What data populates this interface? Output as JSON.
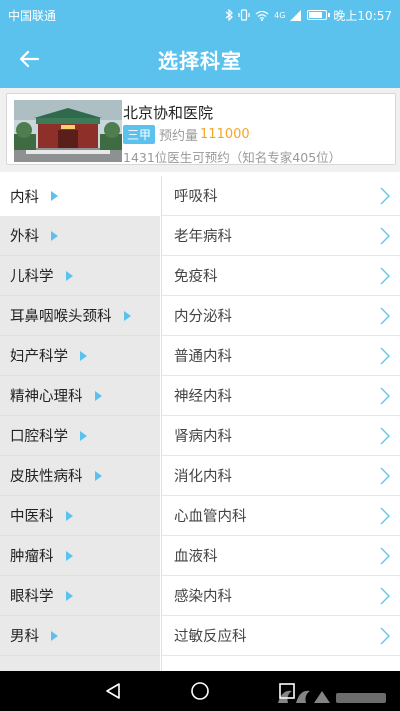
{
  "status": {
    "carrier": "中国联通",
    "network": "4G",
    "time": "晚上10:57",
    "battery_level": 0.85
  },
  "header": {
    "title": "选择科室",
    "background": "#5bc2ee"
  },
  "hospital": {
    "name": "北京协和医院",
    "grade": "三甲",
    "appointment_label": "预约量",
    "appointment_count": "111000",
    "doctor_info": "1431位医生可预约（知名专家405位）"
  },
  "departments": [
    {
      "label": "内科",
      "active": true
    },
    {
      "label": "外科",
      "active": false
    },
    {
      "label": "儿科学",
      "active": false
    },
    {
      "label": "耳鼻咽喉头颈科",
      "active": false
    },
    {
      "label": "妇产科学",
      "active": false
    },
    {
      "label": "精神心理科",
      "active": false
    },
    {
      "label": "口腔科学",
      "active": false
    },
    {
      "label": "皮肤性病科",
      "active": false
    },
    {
      "label": "中医科",
      "active": false
    },
    {
      "label": "肿瘤科",
      "active": false
    },
    {
      "label": "眼科学",
      "active": false
    },
    {
      "label": "男科",
      "active": false
    }
  ],
  "subdepartments": [
    {
      "label": "呼吸科"
    },
    {
      "label": "老年病科"
    },
    {
      "label": "免疫科"
    },
    {
      "label": "内分泌科"
    },
    {
      "label": "普通内科"
    },
    {
      "label": "神经内科"
    },
    {
      "label": "肾病内科"
    },
    {
      "label": "消化内科"
    },
    {
      "label": "心血管内科"
    },
    {
      "label": "血液科"
    },
    {
      "label": "感染内科"
    },
    {
      "label": "过敏反应科"
    }
  ],
  "colors": {
    "accent": "#5bc2ee",
    "count": "#f5a623",
    "left_bg": "#e9e9e9"
  }
}
